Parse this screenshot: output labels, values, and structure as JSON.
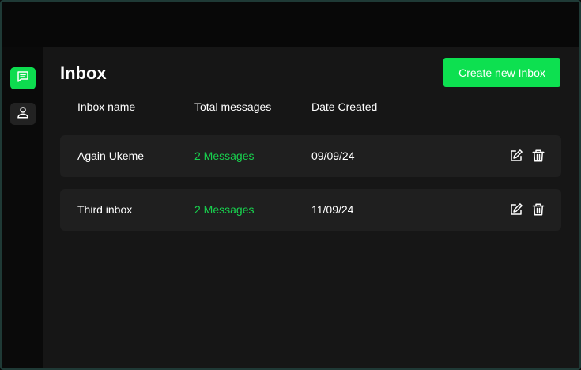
{
  "header": {
    "title": "Inbox",
    "create_button_label": "Create new Inbox"
  },
  "sidebar": {
    "items": [
      {
        "name": "messages",
        "icon": "message-icon",
        "active": true
      },
      {
        "name": "profile",
        "icon": "user-icon",
        "active": false
      }
    ]
  },
  "table": {
    "columns": [
      "Inbox name",
      "Total messages",
      "Date Created"
    ],
    "rows": [
      {
        "name": "Again Ukeme",
        "messages": "2 Messages",
        "date": "09/09/24"
      },
      {
        "name": "Third inbox",
        "messages": "2 Messages",
        "date": "11/09/24"
      }
    ]
  },
  "colors": {
    "accent": "#0de050",
    "count_text": "#18d04e",
    "panel": "#161616",
    "row": "#1f1f1f"
  }
}
